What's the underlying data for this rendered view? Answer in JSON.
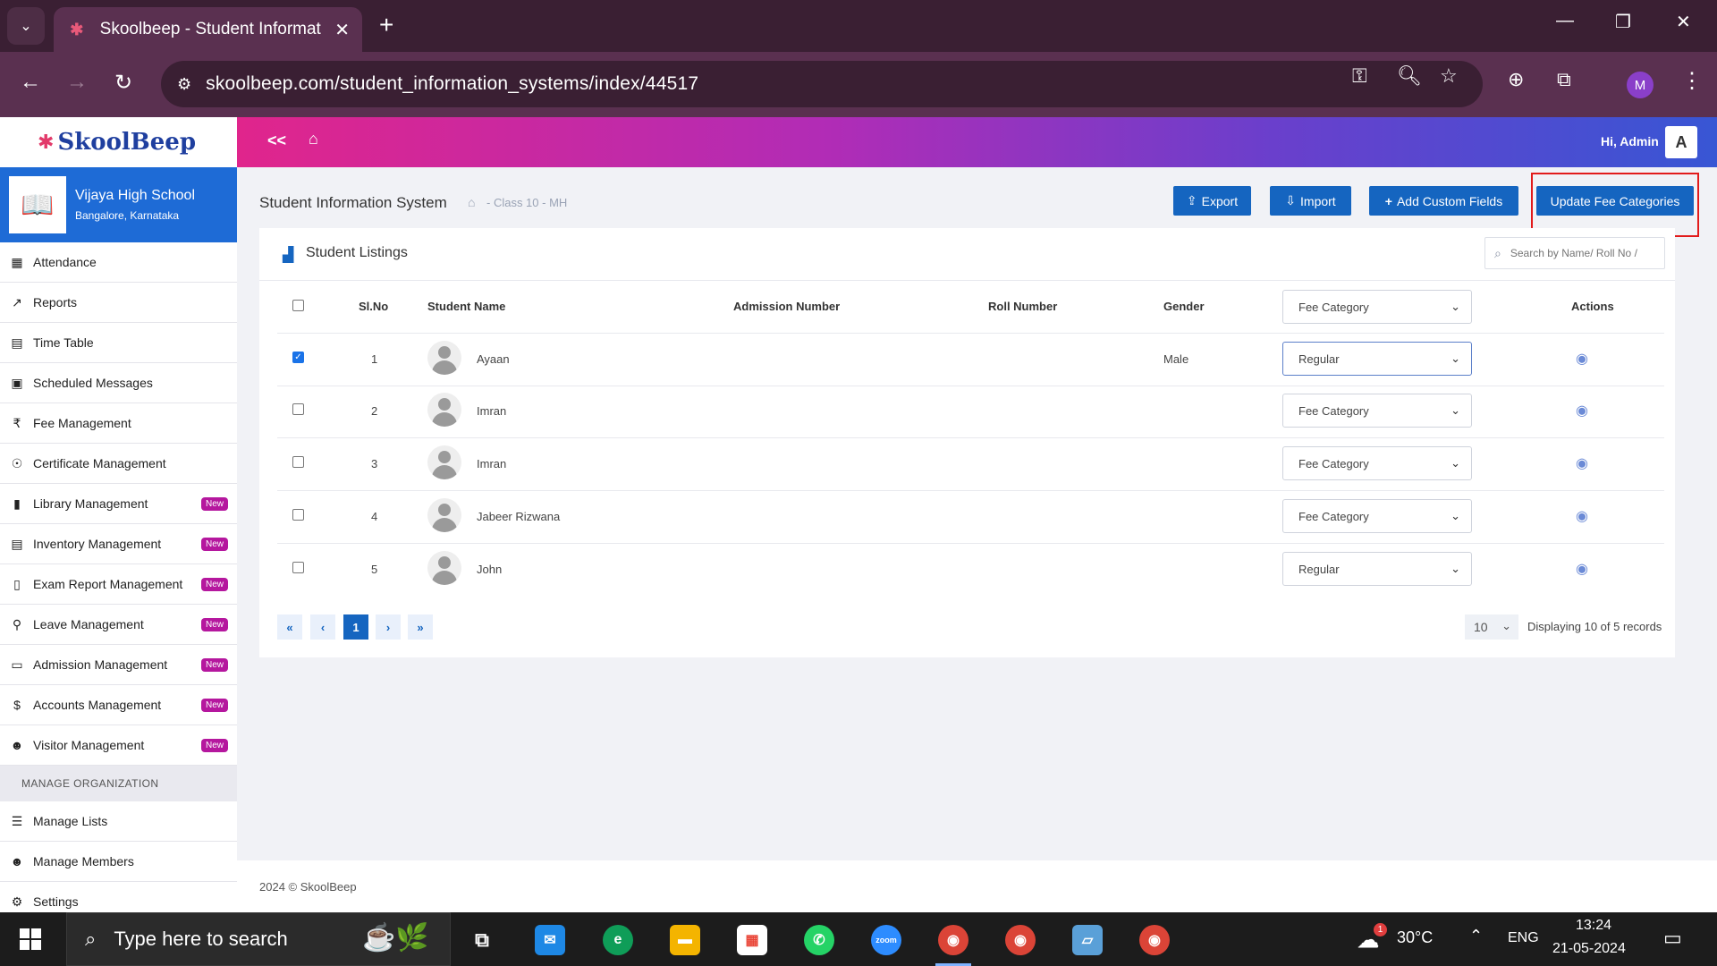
{
  "browser": {
    "tab_title": "Skoolbeep - Student Informatio",
    "url": "skoolbeep.com/student_information_systems/index/44517",
    "profile_initial": "M"
  },
  "app": {
    "logo": "SkoolBeep",
    "greeting": "Hi, Admin",
    "avatar_initial": "A",
    "collapse_label": "<<"
  },
  "school": {
    "name": "Vijaya High School",
    "location": "Bangalore, Karnataka"
  },
  "sidebar": {
    "items": [
      {
        "label": "Attendance",
        "icon": "calendar-icon",
        "new": false
      },
      {
        "label": "Reports",
        "icon": "chart-icon",
        "new": false
      },
      {
        "label": "Time Table",
        "icon": "timetable-icon",
        "new": false
      },
      {
        "label": "Scheduled Messages",
        "icon": "calendar-check-icon",
        "new": false
      },
      {
        "label": "Fee Management",
        "icon": "rupee-icon",
        "new": false
      },
      {
        "label": "Certificate Management",
        "icon": "certificate-icon",
        "new": false
      },
      {
        "label": "Library Management",
        "icon": "book-icon",
        "new": true
      },
      {
        "label": "Inventory Management",
        "icon": "inventory-icon",
        "new": true
      },
      {
        "label": "Exam Report Management",
        "icon": "document-icon",
        "new": true
      },
      {
        "label": "Leave Management",
        "icon": "leave-icon",
        "new": true
      },
      {
        "label": "Admission Management",
        "icon": "id-card-icon",
        "new": true
      },
      {
        "label": "Accounts Management",
        "icon": "accounts-icon",
        "new": true
      },
      {
        "label": "Visitor Management",
        "icon": "users-icon",
        "new": true
      }
    ],
    "section_title": "MANAGE ORGANIZATION",
    "org_items": [
      {
        "label": "Manage Lists",
        "icon": "list-icon"
      },
      {
        "label": "Manage Members",
        "icon": "users-icon"
      },
      {
        "label": "Settings",
        "icon": "gear-icon"
      }
    ],
    "new_badge": "New"
  },
  "page": {
    "title": "Student Information System",
    "breadcrumb": "- Class 10 - MH",
    "buttons": {
      "export": "Export",
      "import": "Import",
      "add_custom_fields": "Add Custom Fields",
      "update_fee_categories": "Update Fee Categories"
    }
  },
  "listing": {
    "title": "Student Listings",
    "search_placeholder": "Search by Name/ Roll No /",
    "columns": {
      "slno": "Sl.No",
      "name": "Student Name",
      "admission": "Admission Number",
      "roll": "Roll Number",
      "gender": "Gender",
      "fee_category": "Fee Category",
      "actions": "Actions"
    },
    "rows": [
      {
        "slno": "1",
        "name": "Ayaan",
        "admission": "",
        "roll": "",
        "gender": "Male",
        "fee_category": "Regular",
        "checked": true
      },
      {
        "slno": "2",
        "name": "Imran",
        "admission": "",
        "roll": "",
        "gender": "",
        "fee_category": "Fee Category",
        "checked": false
      },
      {
        "slno": "3",
        "name": "Imran",
        "admission": "",
        "roll": "",
        "gender": "",
        "fee_category": "Fee Category",
        "checked": false
      },
      {
        "slno": "4",
        "name": "Jabeer Rizwana",
        "admission": "",
        "roll": "",
        "gender": "",
        "fee_category": "Fee Category",
        "checked": false
      },
      {
        "slno": "5",
        "name": "John",
        "admission": "",
        "roll": "",
        "gender": "",
        "fee_category": "Regular",
        "checked": false
      }
    ],
    "pagination": {
      "first": "«",
      "prev": "‹",
      "current": "1",
      "next": "›",
      "last": "»",
      "page_size": "10",
      "records_text": "Displaying 10 of 5 records"
    }
  },
  "footer": {
    "text": "2024 © SkoolBeep"
  },
  "taskbar": {
    "search_placeholder": "Type here to search",
    "temperature": "30°C",
    "language": "ENG",
    "time": "13:24",
    "date": "21-05-2024",
    "weather_badge": "1"
  },
  "colors": {
    "primary": "#1565c0",
    "sidebar_school": "#1e6bd6",
    "new_badge": "#b5179e",
    "highlight_box": "#e21b1b"
  }
}
